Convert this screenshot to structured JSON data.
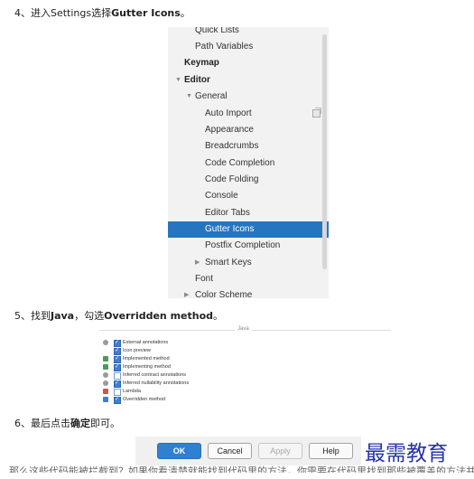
{
  "steps": [
    {
      "prefix": "4、进入Settings选择",
      "bold": "Gutter Icons",
      "suffix": "。"
    },
    {
      "prefix": "5、找到",
      "bold": "Java",
      "middle": "，勾选",
      "bold2": "Overridden method",
      "suffix": "。"
    },
    {
      "prefix": "6、最后点击",
      "bold": "确定",
      "suffix": "即可。"
    }
  ],
  "settings_tree": {
    "items": [
      {
        "label": "Quick Lists",
        "arrow": ""
      },
      {
        "label": "Path Variables",
        "arrow": ""
      },
      {
        "label": "Keymap",
        "arrow": ""
      },
      {
        "label": "Editor",
        "arrow": "▼"
      },
      {
        "label": "General",
        "arrow": "▼"
      },
      {
        "label": "Auto Import",
        "arrow": "",
        "icon": "copy-icon"
      },
      {
        "label": "Appearance",
        "arrow": ""
      },
      {
        "label": "Breadcrumbs",
        "arrow": ""
      },
      {
        "label": "Code Completion",
        "arrow": ""
      },
      {
        "label": "Code Folding",
        "arrow": ""
      },
      {
        "label": "Console",
        "arrow": ""
      },
      {
        "label": "Editor Tabs",
        "arrow": ""
      },
      {
        "label": "Gutter Icons",
        "arrow": "",
        "selected": true
      },
      {
        "label": "Postfix Completion",
        "arrow": ""
      },
      {
        "label": "Smart Keys",
        "arrow": "▶"
      },
      {
        "label": "Font",
        "arrow": ""
      },
      {
        "label": "Color Scheme",
        "arrow": "▶"
      }
    ],
    "selected_color": "#2675bf"
  },
  "java_panel": {
    "title": "Java",
    "items": [
      {
        "label": "External annotations",
        "checked": true,
        "icon": "gray-circle-icon"
      },
      {
        "label": "Icon preview",
        "checked": true,
        "icon": ""
      },
      {
        "label": "Implemented method",
        "checked": true,
        "icon": "implemented-icon"
      },
      {
        "label": "Implementing method",
        "checked": true,
        "icon": "implementing-icon"
      },
      {
        "label": "Inferred contract annotations",
        "checked": false,
        "icon": "gray-circle-icon"
      },
      {
        "label": "Inferred nullability annotations",
        "checked": true,
        "icon": "gray-circle-icon"
      },
      {
        "label": "Lambda",
        "checked": false,
        "icon": "lambda-icon"
      },
      {
        "label": "Overridden method",
        "checked": true,
        "icon": "overridden-icon"
      }
    ]
  },
  "buttons": {
    "ok": "OK",
    "cancel": "Cancel",
    "apply": "Apply",
    "help": "Help"
  },
  "watermark": "最需教育",
  "cut_text": "那么这些代码能被拦截到？如果你看清楚就能找到代码里的方法，你需要在代码里找到那些被覆盖的方法并标记它们。"
}
